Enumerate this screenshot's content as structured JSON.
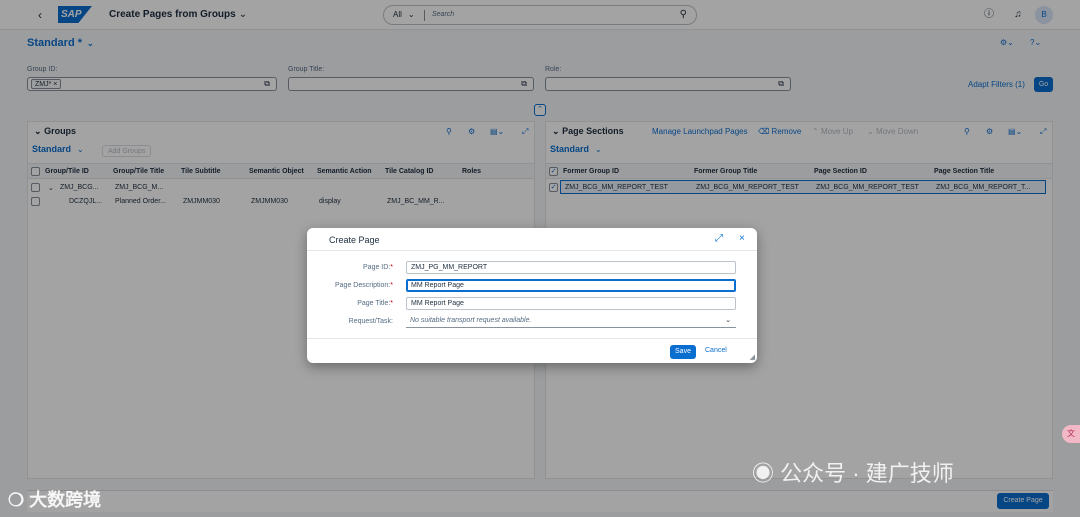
{
  "shell": {
    "app_title": "Create Pages from Groups",
    "search_scope": "All",
    "search_placeholder": "Search",
    "avatar_initial": "B"
  },
  "filterbar": {
    "variant": "Standard *",
    "group_id_label": "Group ID:",
    "group_id_token": "ZMJ*",
    "group_title_label": "Group Title:",
    "role_label": "Role:",
    "adapt_filters": "Adapt Filters (1)",
    "go": "Go"
  },
  "groups_panel": {
    "title": "Groups",
    "variant": "Standard",
    "add_groups": "Add Groups",
    "columns": [
      "Group/Tile ID",
      "Group/Tile Title",
      "Tile Subtitle",
      "Semantic Object",
      "Semantic Action",
      "Tile Catalog ID",
      "Roles"
    ],
    "rows": [
      {
        "id": "ZMJ_BCG...",
        "title": "ZMJ_BCG_M...",
        "subtitle": "",
        "semantic_object": "",
        "semantic_action": "",
        "catalog": "",
        "roles": ""
      },
      {
        "id": "DCZQJL...",
        "title": "Planned Order...",
        "subtitle": "ZMJMM030",
        "semantic_object": "ZMJMM030",
        "semantic_action": "display",
        "catalog": "ZMJ_BC_MM_R...",
        "roles": ""
      }
    ]
  },
  "sections_panel": {
    "title": "Page Sections",
    "manage": "Manage Launchpad Pages",
    "remove": "Remove",
    "move_up": "Move Up",
    "move_down": "Move Down",
    "variant": "Standard",
    "columns": [
      "Former Group ID",
      "Former Group Title",
      "Page Section ID",
      "Page Section Title"
    ],
    "rows": [
      {
        "former_id": "ZMJ_BCG_MM_REPORT_TEST",
        "former_title": "ZMJ_BCG_MM_REPORT_TEST",
        "section_id": "ZMJ_BCG_MM_REPORT_TEST",
        "section_title": "ZMJ_BCG_MM_REPORT_T..."
      }
    ]
  },
  "dialog": {
    "title": "Create Page",
    "page_id_label": "Page ID:",
    "page_id_value": "ZMJ_PG_MM_REPORT",
    "page_desc_label": "Page Description:",
    "page_desc_value": "MM Report Page",
    "page_title_label": "Page Title:",
    "page_title_value": "MM Report Page",
    "request_label": "Request/Task:",
    "request_value": "No suitable transport request available.",
    "save": "Save",
    "cancel": "Cancel"
  },
  "footer": {
    "create_page": "Create Page"
  },
  "watermarks": {
    "wechat": "公众号 · 建广技师",
    "corner": "大数跨境"
  }
}
